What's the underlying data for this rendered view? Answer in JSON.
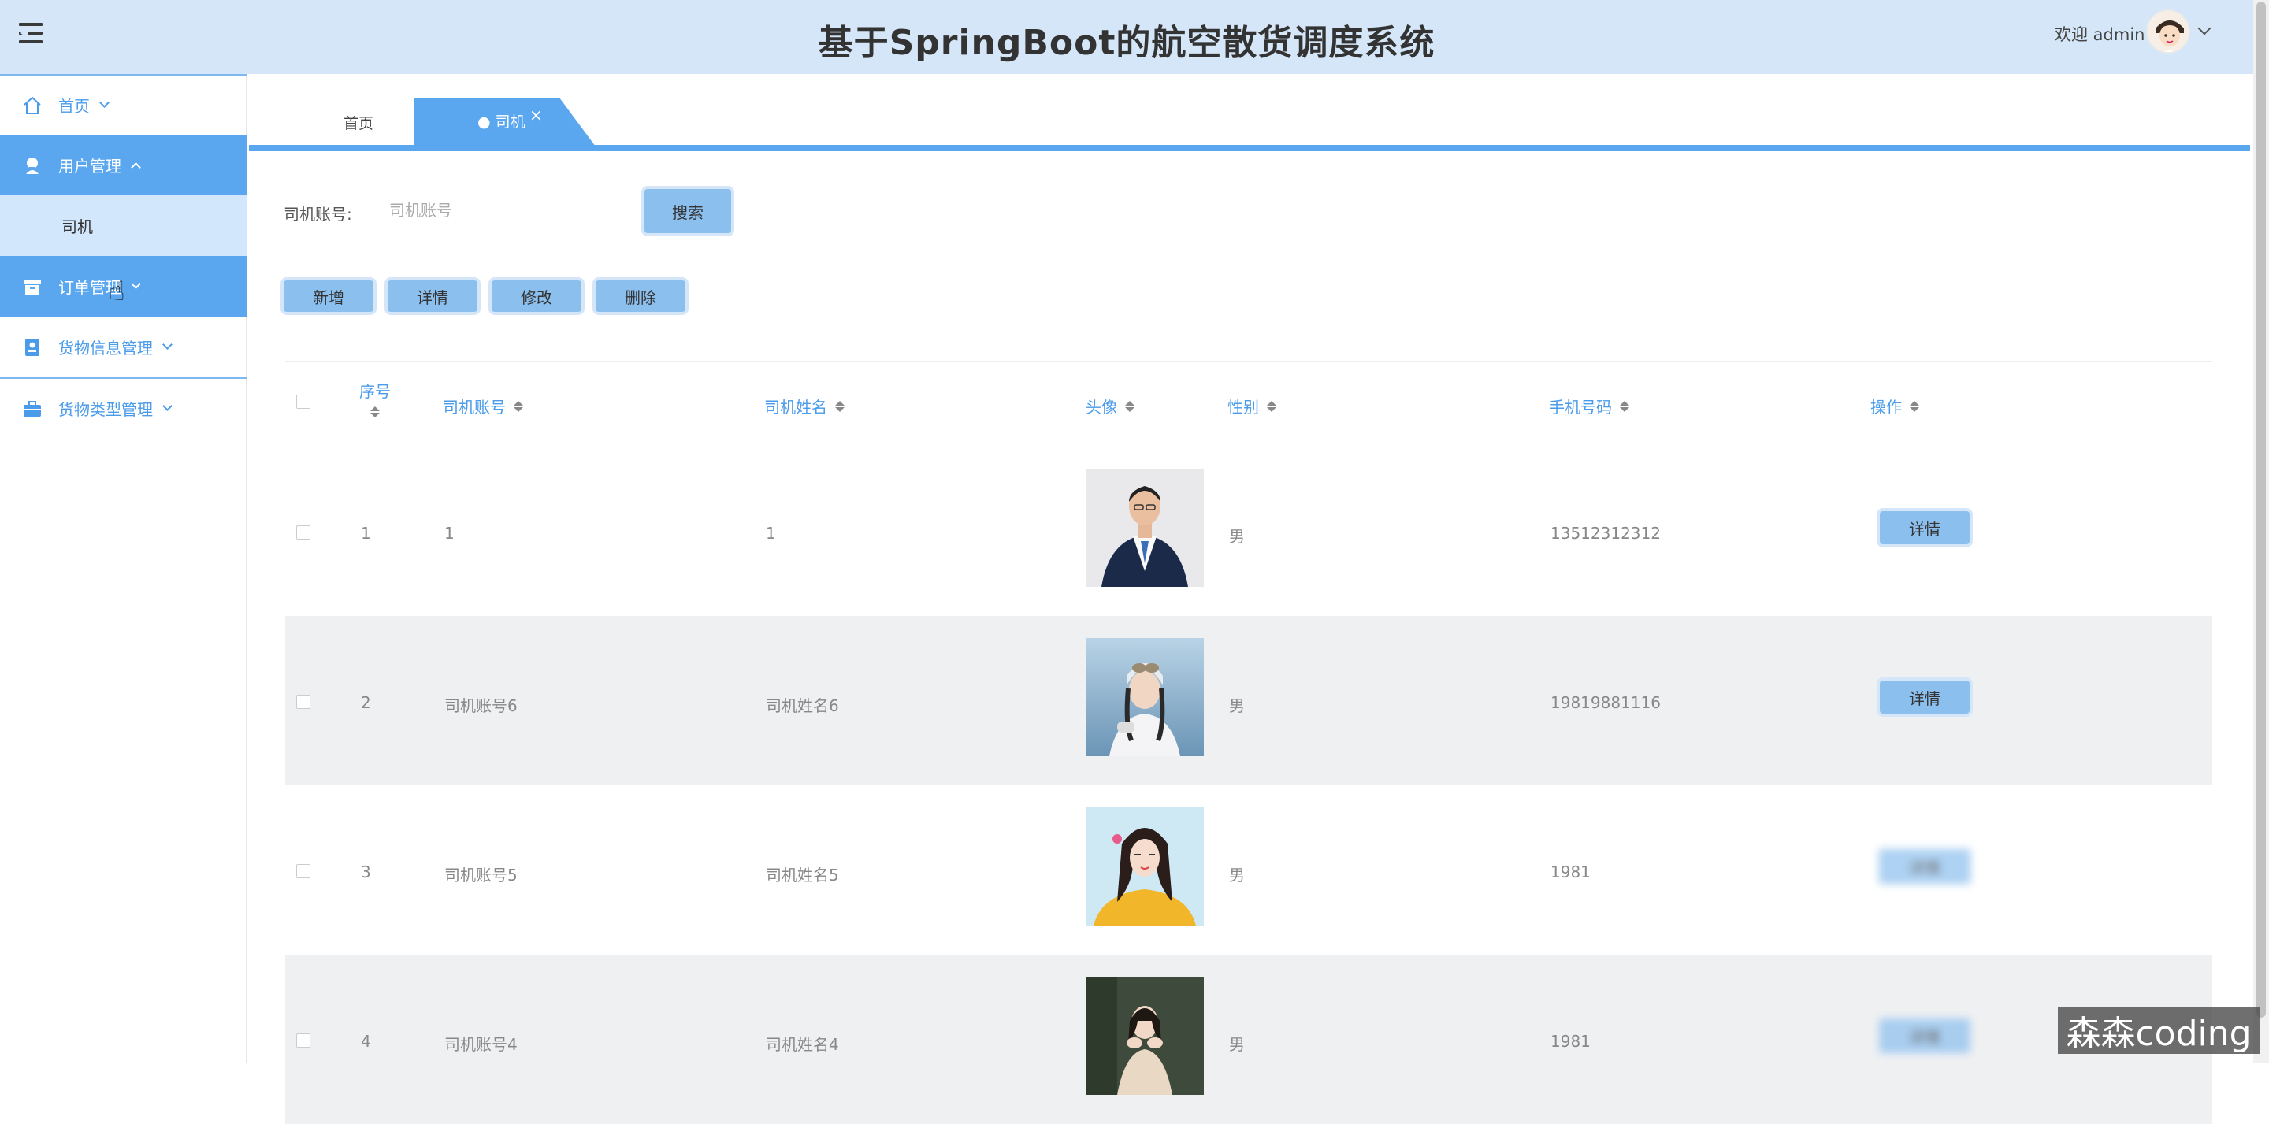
{
  "header": {
    "title": "基于SpringBoot的航空散货调度系统",
    "welcome": "欢迎 admin"
  },
  "sidebar": {
    "items": [
      {
        "label": "首页",
        "icon": "home-icon"
      },
      {
        "label": "用户管理",
        "icon": "user-icon"
      },
      {
        "label": "司机",
        "icon": ""
      },
      {
        "label": "订单管理",
        "icon": "box-icon"
      },
      {
        "label": "货物信息管理",
        "icon": "contact-icon"
      },
      {
        "label": "货物类型管理",
        "icon": "briefcase-icon"
      }
    ]
  },
  "tabs": [
    {
      "label": "首页"
    },
    {
      "label": "● 司机",
      "close": "×"
    }
  ],
  "search": {
    "label": "司机账号:",
    "placeholder": "司机账号",
    "button": "搜索"
  },
  "actions": {
    "add": "新增",
    "detail": "详情",
    "edit": "修改",
    "delete": "删除"
  },
  "table": {
    "headers": [
      "序号",
      "司机账号",
      "司机姓名",
      "头像",
      "性别",
      "手机号码",
      "操作"
    ],
    "rows": [
      {
        "index": "1",
        "account": "1",
        "name": "1",
        "gender": "男",
        "phone": "13512312312",
        "action": "详情"
      },
      {
        "index": "2",
        "account": "司机账号6",
        "name": "司机姓名6",
        "gender": "男",
        "phone": "19819881116",
        "action": "详情"
      },
      {
        "index": "3",
        "account": "司机账号5",
        "name": "司机姓名5",
        "gender": "男",
        "phone": "1981",
        "action": "详情"
      },
      {
        "index": "4",
        "account": "司机账号4",
        "name": "司机姓名4",
        "gender": "男",
        "phone": "1981",
        "action": "详情"
      }
    ]
  },
  "watermark": "森森coding",
  "colors": {
    "accent": "#5aa7f0",
    "header_bg": "#d4e6f7",
    "button_bg": "#8bbfee"
  }
}
